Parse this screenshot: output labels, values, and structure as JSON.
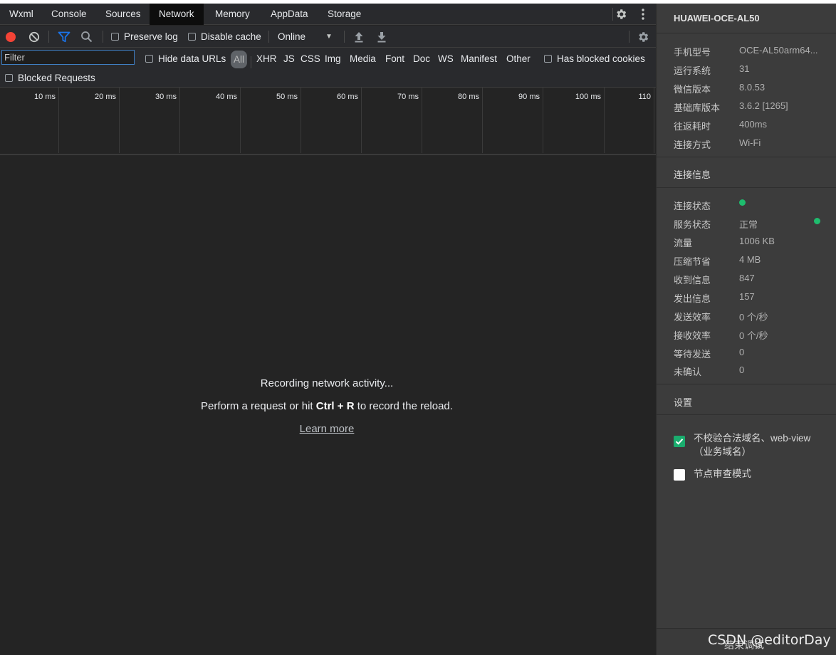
{
  "tabs": [
    {
      "label": "Wxml",
      "active": false
    },
    {
      "label": "Console",
      "active": false
    },
    {
      "label": "Sources",
      "active": false
    },
    {
      "label": "Network",
      "active": true
    },
    {
      "label": "Memory",
      "active": false
    },
    {
      "label": "AppData",
      "active": false
    },
    {
      "label": "Storage",
      "active": false
    }
  ],
  "toolbar": {
    "preserve_log": "Preserve log",
    "disable_cache": "Disable cache",
    "throttling": "Online",
    "record_color": "#f44336",
    "filter_icon_color": "#1a73e8"
  },
  "filterbar": {
    "filter_placeholder": "Filter",
    "hide_data_urls": "Hide data URLs",
    "types": [
      "All",
      "XHR",
      "JS",
      "CSS",
      "Img",
      "Media",
      "Font",
      "Doc",
      "WS",
      "Manifest",
      "Other"
    ],
    "has_blocked_cookies": "Has blocked cookies",
    "blocked_requests": "Blocked Requests"
  },
  "timeline": {
    "ticks": [
      "10 ms",
      "20 ms",
      "30 ms",
      "40 ms",
      "50 ms",
      "60 ms",
      "70 ms",
      "80 ms",
      "90 ms",
      "100 ms",
      "110"
    ]
  },
  "empty_state": {
    "line1": "Recording network activity...",
    "line2_prefix": "Perform a request or hit ",
    "line2_key": "Ctrl + R",
    "line2_suffix": " to record the reload.",
    "learn_more": "Learn more"
  },
  "sidepanel": {
    "device": "HUAWEI-OCE-AL50",
    "device_info": [
      {
        "key": "手机型号",
        "value": "OCE-AL50arm64..."
      },
      {
        "key": "运行系统",
        "value": "31"
      },
      {
        "key": "微信版本",
        "value": "8.0.53"
      },
      {
        "key": "基础库版本",
        "value": "3.6.2 [1265]"
      },
      {
        "key": "往返耗时",
        "value": "400ms"
      },
      {
        "key": "连接方式",
        "value": "Wi-Fi"
      }
    ],
    "connection_title": "连接信息",
    "connection_info": [
      {
        "key": "连接状态",
        "value": ""
      },
      {
        "key": "服务状态",
        "value": "正常"
      },
      {
        "key": "流量",
        "value": "1006 KB"
      },
      {
        "key": "压缩节省",
        "value": "4 MB"
      },
      {
        "key": "收到信息",
        "value": "847"
      },
      {
        "key": "发出信息",
        "value": "157"
      },
      {
        "key": "发送效率",
        "value": "0 个/秒"
      },
      {
        "key": "接收效率",
        "value": "0 个/秒"
      },
      {
        "key": "等待发送",
        "value": "0"
      },
      {
        "key": "未确认",
        "value": "0"
      }
    ],
    "status_color": "#1ebd6e",
    "settings_title": "设置",
    "settings": [
      {
        "label": "不校验合法域名、web-view（业务域名）",
        "checked": true
      },
      {
        "label": "节点审查模式",
        "checked": false
      }
    ],
    "footer_button": "结束调试"
  },
  "watermark": "CSDN @editorDay"
}
